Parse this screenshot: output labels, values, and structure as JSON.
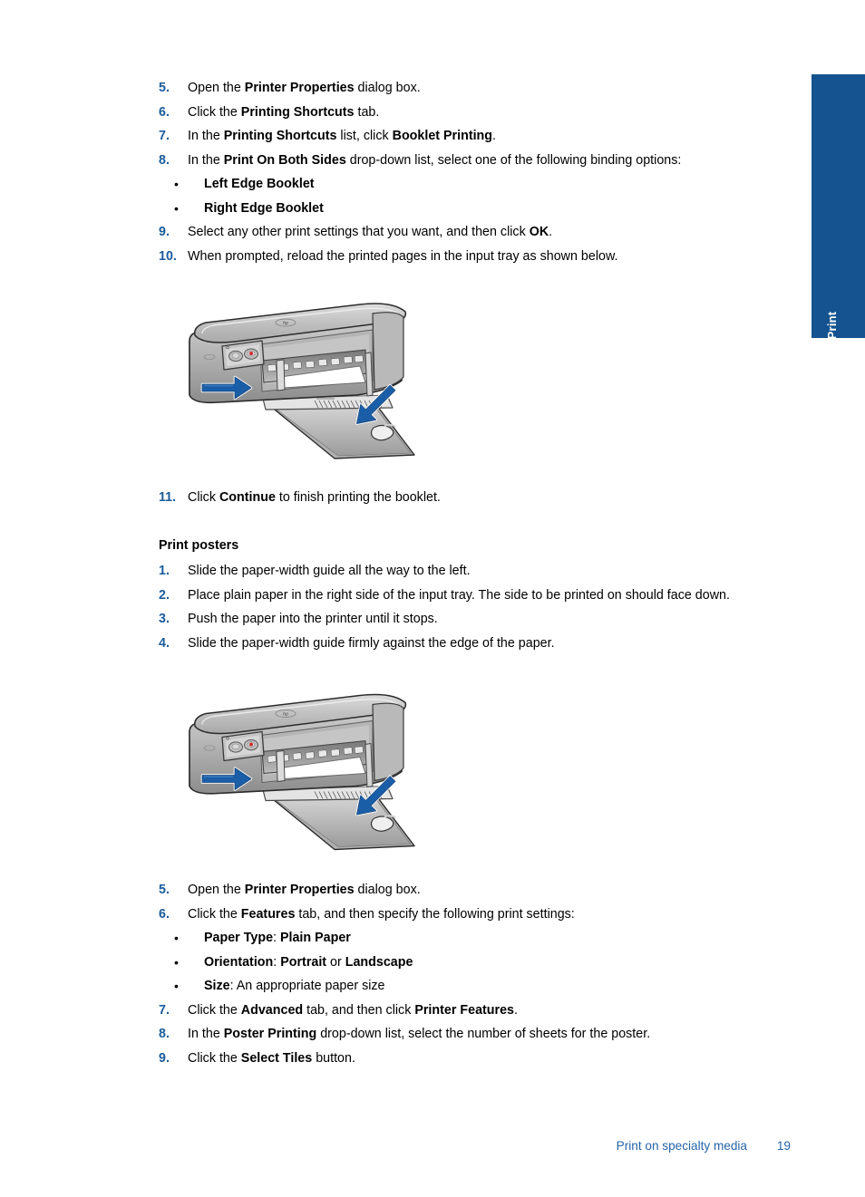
{
  "side_tab": {
    "label": "Print",
    "color": "#14538f"
  },
  "accent_color": "#1b5c9b",
  "booklet_steps": [
    {
      "num": "5.",
      "html": "Open the <b>Printer Properties</b> dialog box."
    },
    {
      "num": "6.",
      "html": "Click the <b>Printing Shortcuts</b> tab."
    },
    {
      "num": "7.",
      "html": "In the <b>Printing Shortcuts</b> list, click <b>Booklet Printing</b>."
    },
    {
      "num": "8.",
      "html": "In the <b>Print On Both Sides</b> drop-down list, select one of the following binding options:"
    }
  ],
  "booklet_bullets": [
    {
      "dot": "•",
      "html": "<b>Left Edge Booklet</b>"
    },
    {
      "dot": "•",
      "html": "<b>Right Edge Booklet</b>"
    }
  ],
  "booklet_steps_tail": [
    {
      "num": "9.",
      "html": "Select any other print settings that you want, and then click <b>OK</b>."
    },
    {
      "num": "10.",
      "html": "When prompted, reload the printed pages in the input tray as shown below."
    }
  ],
  "booklet_step_11": {
    "num": "11.",
    "html": "Click <b>Continue</b> to finish printing the booklet."
  },
  "posters_heading": "Print posters",
  "poster_steps": [
    {
      "num": "1.",
      "html": "Slide the paper-width guide all the way to the left."
    },
    {
      "num": "2.",
      "html": "Place plain paper in the right side of the input tray. The side to be printed on should face down."
    },
    {
      "num": "3.",
      "html": "Push the paper into the printer until it stops."
    },
    {
      "num": "4.",
      "html": "Slide the paper-width guide firmly against the edge of the paper."
    }
  ],
  "poster_steps_tail": [
    {
      "num": "5.",
      "html": "Open the <b>Printer Properties</b> dialog box."
    },
    {
      "num": "6.",
      "html": "Click the <b>Features</b> tab, and then specify the following print settings:"
    }
  ],
  "poster_bullets": [
    {
      "dot": "•",
      "html": "<b>Paper Type</b>: <b>Plain Paper</b>"
    },
    {
      "dot": "•",
      "html": "<b>Orientation</b>: <b>Portrait</b> or <b>Landscape</b>"
    },
    {
      "dot": "•",
      "html": "<b>Size</b>: An appropriate paper size"
    }
  ],
  "poster_steps_end": [
    {
      "num": "7.",
      "html": "Click the <b>Advanced</b> tab, and then click <b>Printer Features</b>."
    },
    {
      "num": "8.",
      "html": "In the <b>Poster Printing</b> drop-down list, select the number of sheets for the poster."
    },
    {
      "num": "9.",
      "html": "Click the <b>Select Tiles</b> button."
    }
  ],
  "figures": [
    {
      "name": "printer-reload-pages-illustration",
      "alt": "HP Deskjet printer with paper loaded in input tray and two blue arrows"
    },
    {
      "name": "printer-load-paper-illustration",
      "alt": "HP Deskjet printer with paper loaded in input tray and two blue arrows"
    }
  ],
  "footer": {
    "title": "Print on specialty media",
    "page": "19",
    "color": "#2564a8"
  }
}
